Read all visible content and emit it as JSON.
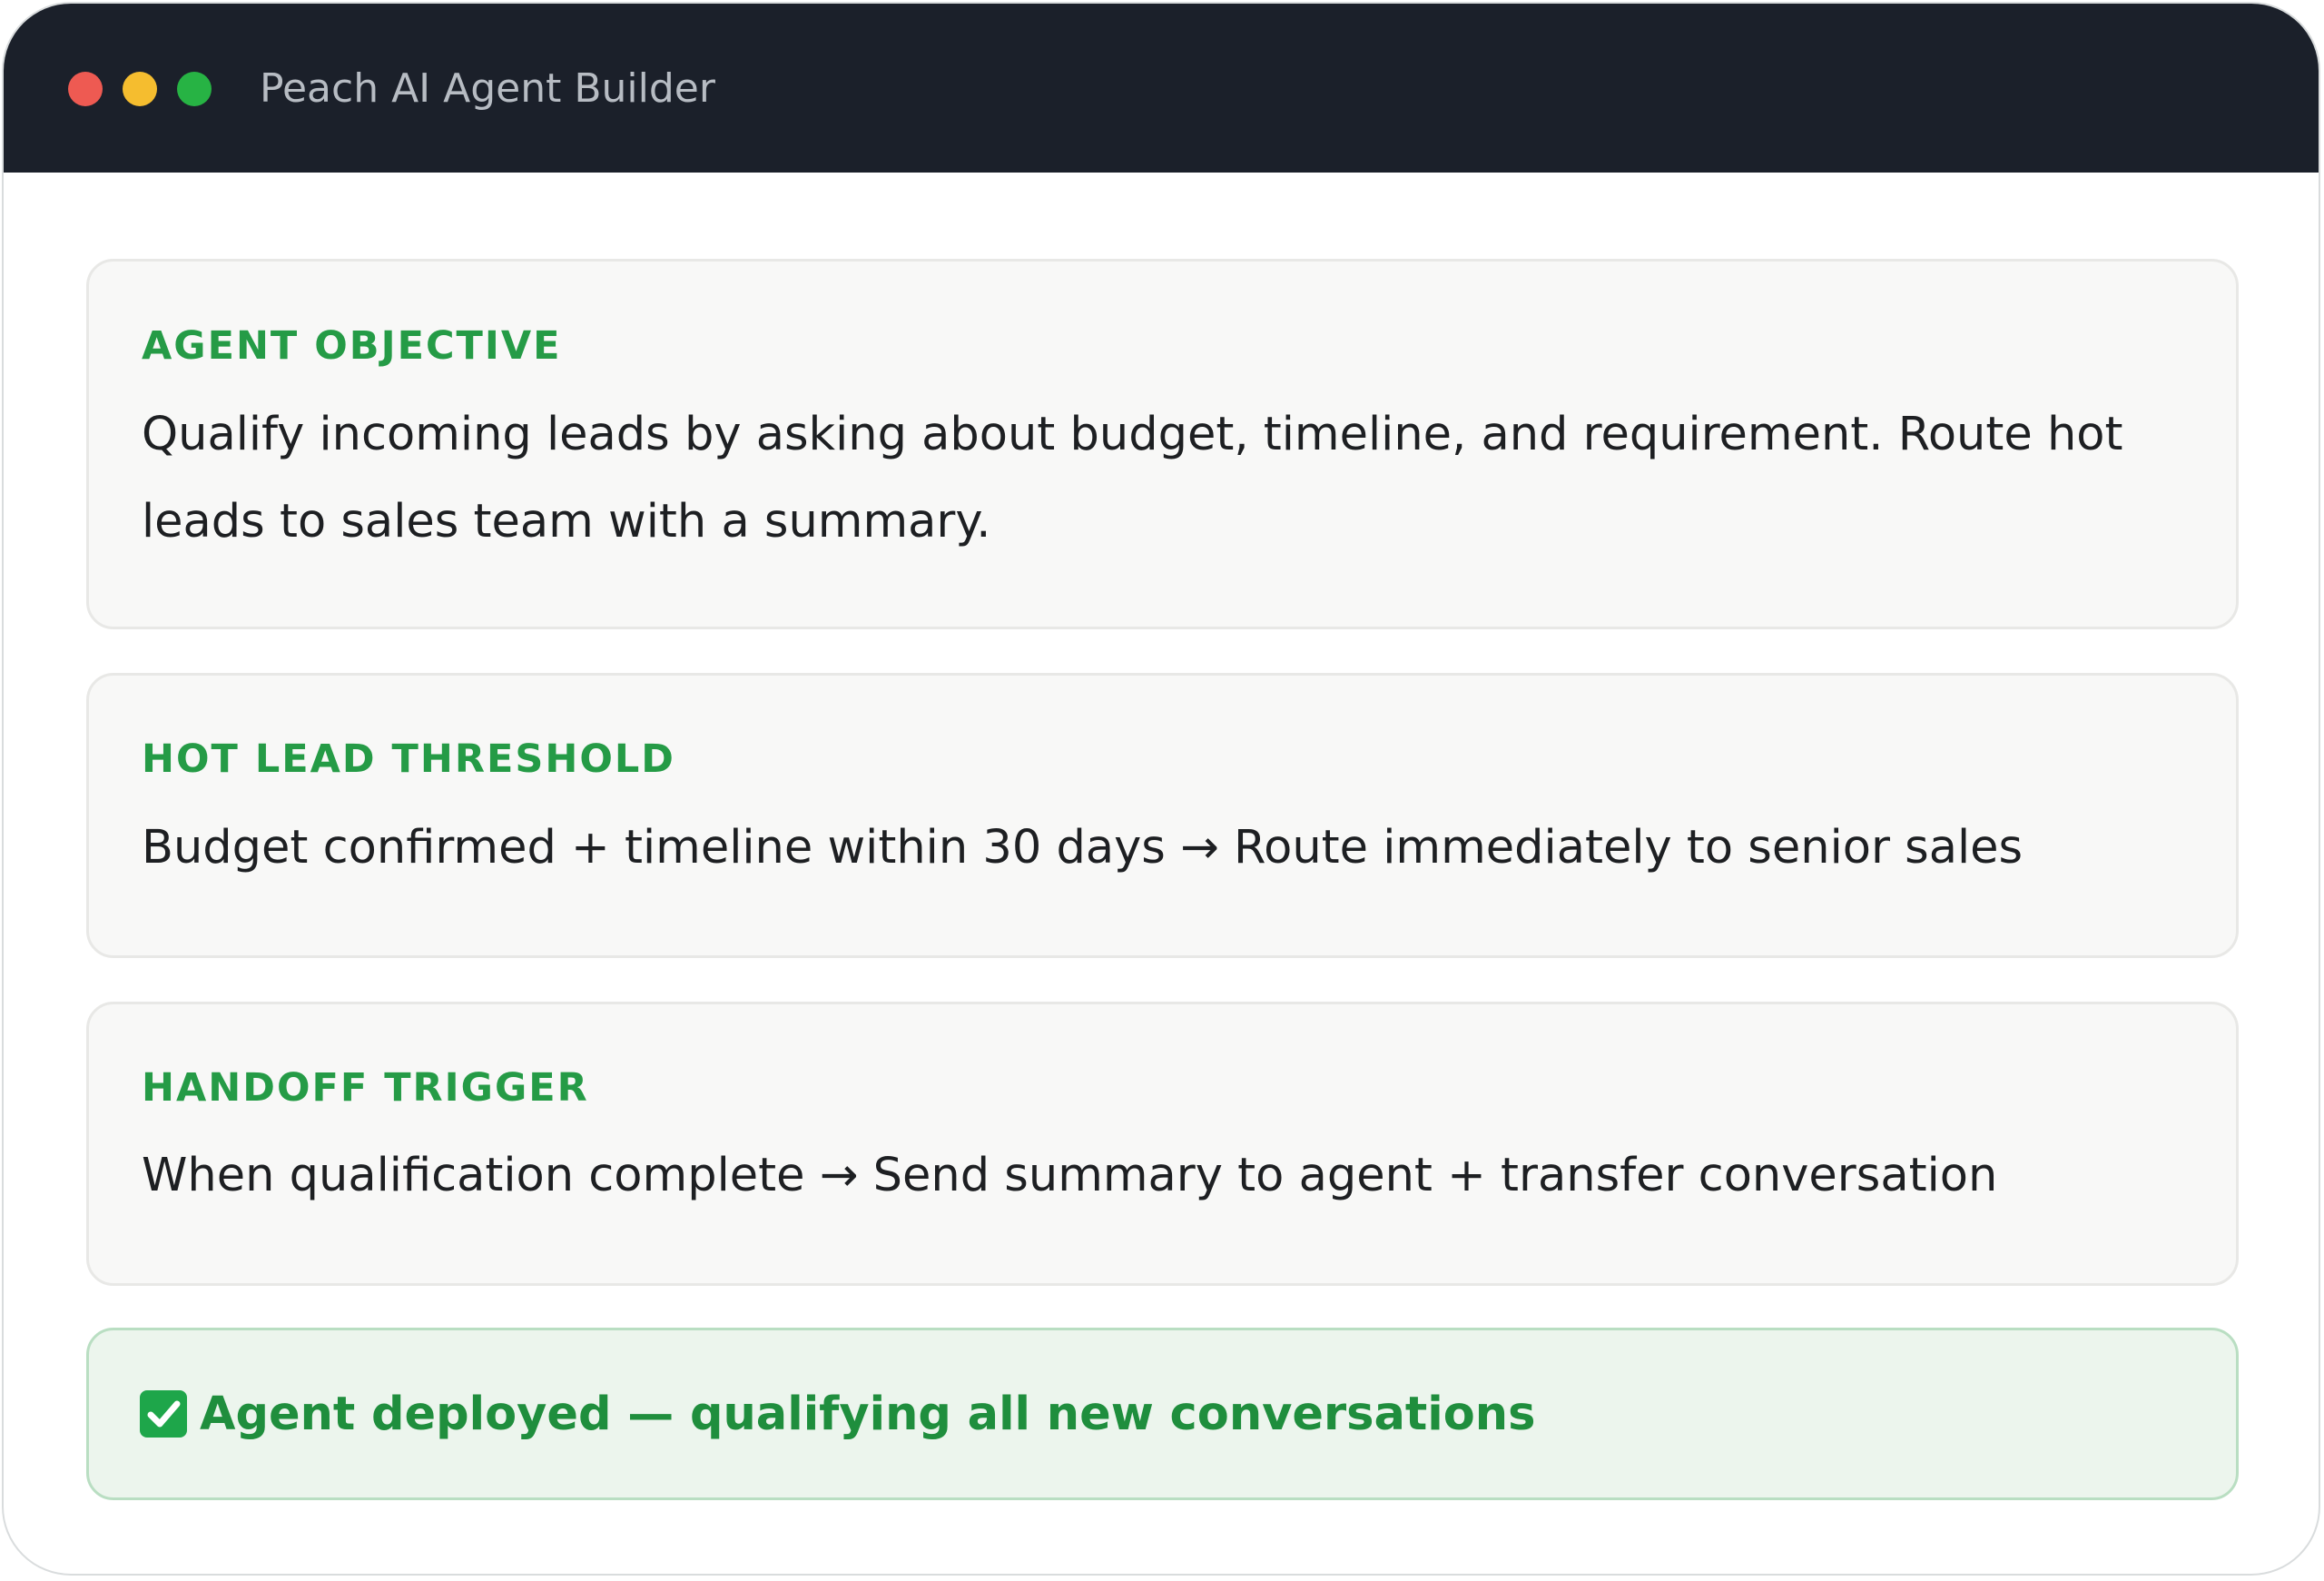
{
  "window": {
    "title": "Peach AI Agent Builder"
  },
  "cards": [
    {
      "label": "AGENT OBJECTIVE",
      "body": "Qualify incoming leads by asking about budget, timeline, and requirement. Route hot leads to sales team with a summary."
    },
    {
      "label": "HOT LEAD THRESHOLD",
      "body": "Budget confirmed + timeline within 30 days → Route immediately to senior sales"
    },
    {
      "label": "HANDOFF TRIGGER",
      "body": "When qualification complete → Send summary to agent + transfer conversation"
    }
  ],
  "status": {
    "icon": "check-box-icon",
    "text": "Agent deployed — qualifying all new conversations"
  },
  "colors": {
    "titlebar": "#1b202a",
    "accent_green": "#259b46",
    "status_background": "#ecf5ed",
    "traffic_red": "#ee5a52",
    "traffic_yellow": "#f5bd2f",
    "traffic_green": "#27b344"
  }
}
